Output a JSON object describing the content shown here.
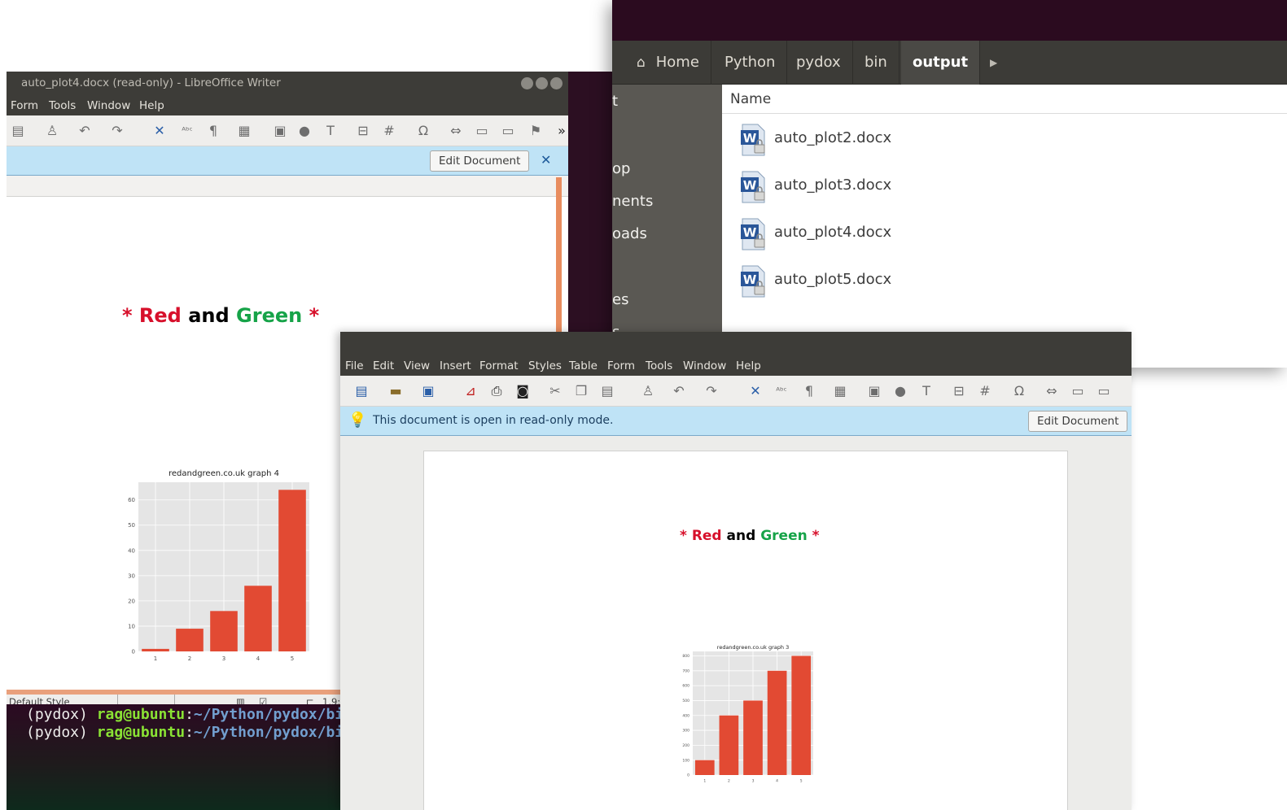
{
  "file_manager": {
    "path": [
      "Home",
      "Python",
      "pydox",
      "bin",
      "output"
    ],
    "sidebar_partial": [
      "t",
      "op",
      "nents",
      "oads",
      "es",
      "s"
    ],
    "column_header": "Name",
    "files": [
      "auto_plot2.docx",
      "auto_plot3.docx",
      "auto_plot4.docx",
      "auto_plot5.docx"
    ]
  },
  "writer_back": {
    "title": "auto_plot4.docx (read-only) - LibreOffice Writer",
    "menu": [
      "Form",
      "Tools",
      "Window",
      "Help"
    ],
    "edit_button": "Edit Document",
    "close_glyph": "✕",
    "overflow_glyph": "»",
    "heading": {
      "star_left": "*",
      "red": "Red",
      "and": "and",
      "green": "Green",
      "star_right": "*"
    },
    "status": {
      "style": "Default Style",
      "zoom": "1.9:"
    }
  },
  "writer_front": {
    "menu": [
      "File",
      "Edit",
      "View",
      "Insert",
      "Format",
      "Styles",
      "Table",
      "Form",
      "Tools",
      "Window",
      "Help"
    ],
    "info_message": "This document is open in read-only mode.",
    "edit_button": "Edit Document",
    "heading": {
      "star_left": "*",
      "red": "Red",
      "and": "and",
      "green": "Green",
      "star_right": "*"
    }
  },
  "terminal": {
    "lines": [
      {
        "prefix": "(pydox) ",
        "user": "rag@ubuntu",
        "sep": ":",
        "path": "~/Python/pydox/bi"
      },
      {
        "prefix": "(pydox) ",
        "user": "rag@ubuntu",
        "sep": ":",
        "path": "~/Python/pydox/bi"
      }
    ]
  },
  "colors": {
    "bar": "#e24a33",
    "plot_bg": "#e5e5e5",
    "red_text": "#d7102b",
    "green_text": "#16a348"
  },
  "chart_data": [
    {
      "type": "bar",
      "title": "redandgreen.co.uk graph 4",
      "categories": [
        "1",
        "2",
        "3",
        "4",
        "5"
      ],
      "values": [
        1,
        9,
        16,
        26,
        64
      ],
      "yticks": [
        0,
        10,
        20,
        30,
        40,
        50,
        60
      ],
      "ylim": [
        0,
        67
      ],
      "xlabel": "",
      "ylabel": "",
      "grid": true
    },
    {
      "type": "bar",
      "title": "redandgreen.co.uk graph 3",
      "categories": [
        "1",
        "2",
        "3",
        "4",
        "5"
      ],
      "values": [
        100,
        400,
        500,
        700,
        800
      ],
      "yticks": [
        0,
        100,
        200,
        300,
        400,
        500,
        600,
        700,
        800
      ],
      "ylim": [
        0,
        830
      ],
      "xlabel": "",
      "ylabel": "",
      "grid": true
    }
  ]
}
